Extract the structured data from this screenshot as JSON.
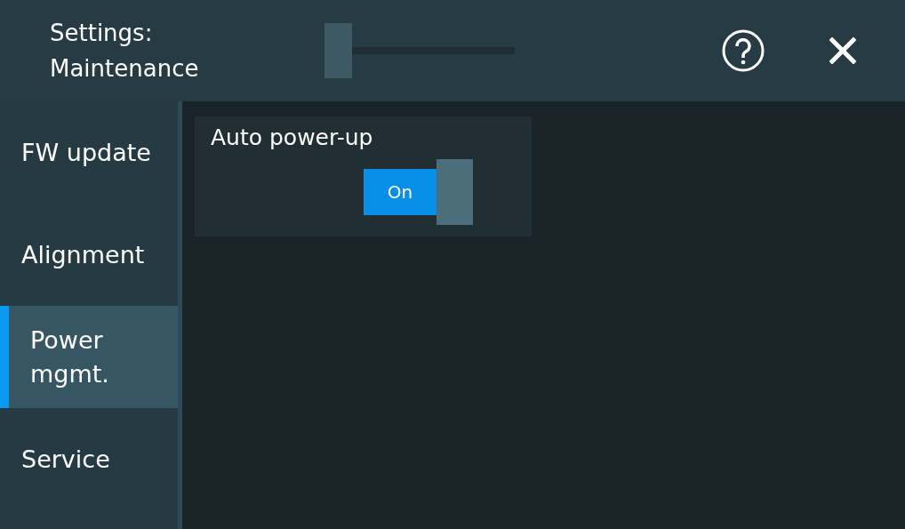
{
  "header": {
    "title_lines": [
      "Settings:",
      "Maintenance"
    ]
  },
  "sidebar": {
    "items": [
      {
        "label": "FW update",
        "selected": false
      },
      {
        "label": "Alignment",
        "selected": false
      },
      {
        "label": "Power mgmt.",
        "selected": true
      },
      {
        "label": "Service",
        "selected": false
      }
    ]
  },
  "settings": [
    {
      "kind": "toggle",
      "label": "Auto power-up",
      "on": true,
      "value": "On"
    }
  ]
}
